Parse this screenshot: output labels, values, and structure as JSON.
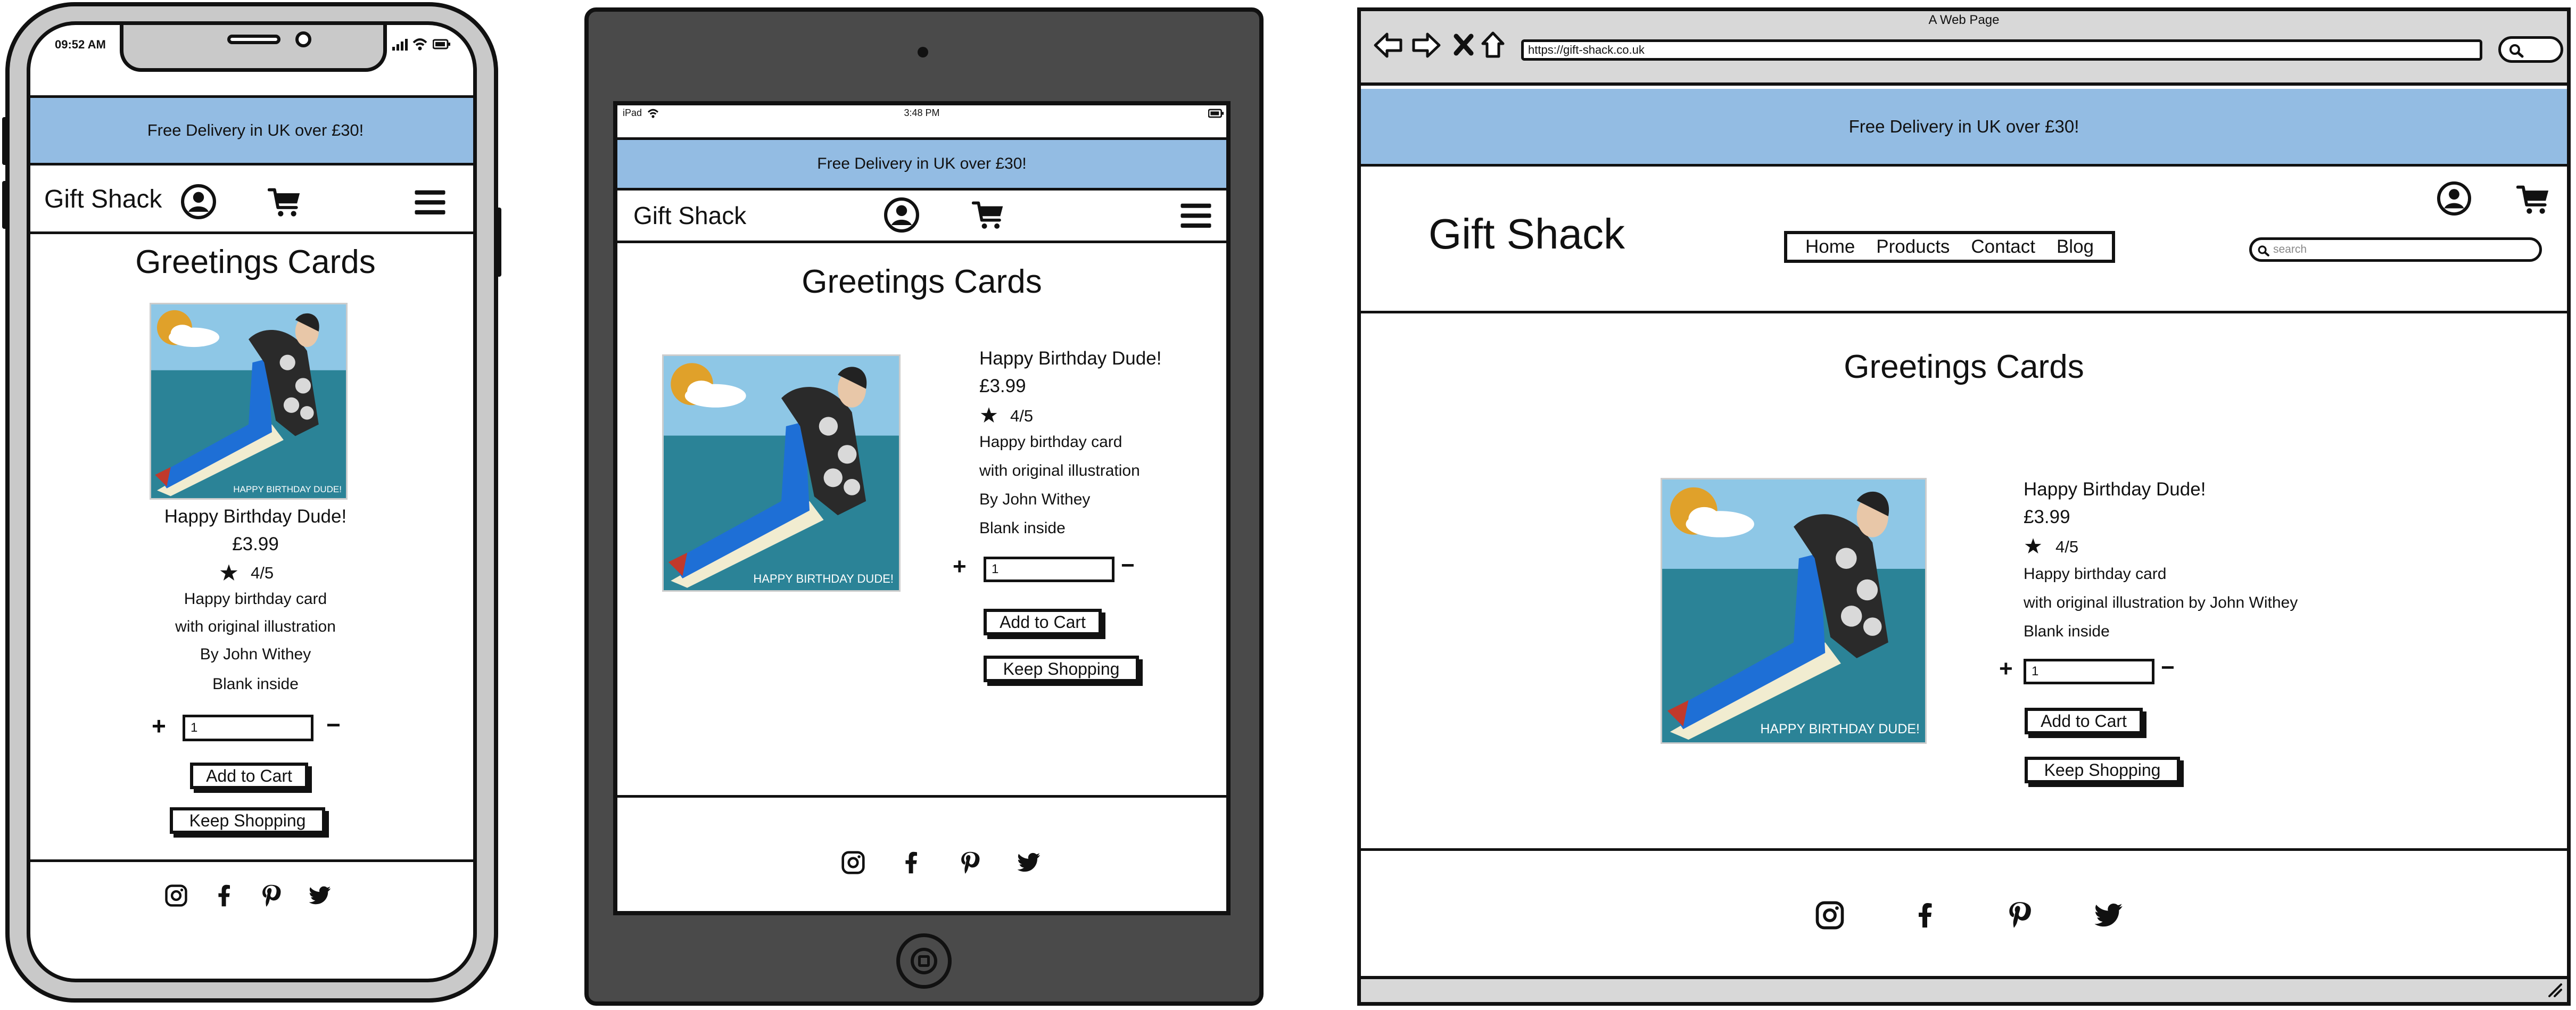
{
  "shared": {
    "banner_text": "Free Delivery in UK over £30!",
    "brand": "Gift Shack",
    "page_title": "Greetings Cards",
    "product": {
      "name": "Happy Birthday Dude!",
      "price": "£3.99",
      "rating": "4/5",
      "desc_line1": "Happy birthday card",
      "desc_line2": "with original illustration",
      "author": "By John Withey",
      "desc_line2_desktop": "with original illustration by John Withey",
      "blank": "Blank inside",
      "image_caption": "HAPPY BIRTHDAY DUDE!"
    },
    "quantity_value": "1",
    "plus_label": "+",
    "minus_label": "−",
    "add_to_cart_label": "Add to Cart",
    "keep_shopping_label": "Keep Shopping",
    "icons": [
      "account-icon",
      "cart-icon",
      "menu-icon",
      "instagram-icon",
      "facebook-icon",
      "pinterest-icon",
      "twitter-icon",
      "star-icon"
    ]
  },
  "phone": {
    "time": "09:52 AM"
  },
  "tablet": {
    "carrier": "iPad",
    "time": "3:48 PM"
  },
  "browser": {
    "window_title": "A Web Page",
    "url": "https://gift-shack.co.uk",
    "search_placeholder": "search",
    "nav": [
      "Home",
      "Products",
      "Contact",
      "Blog"
    ]
  },
  "colors": {
    "banner": "#93bce3",
    "tablet_frame": "#4a4a4a",
    "phone_frame": "#c9c9c9",
    "sea": "#2b8397",
    "sky": "#8ec7e6",
    "sun": "#e0a12a"
  }
}
